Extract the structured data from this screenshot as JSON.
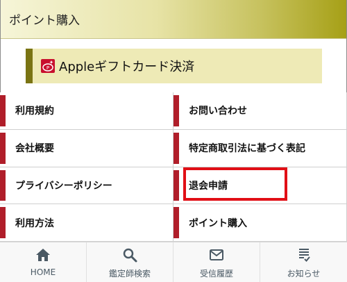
{
  "point_section": {
    "title": "ポイント購入",
    "apple_label": "Appleギフトカード決済"
  },
  "menu": {
    "items": [
      {
        "label": "利用規約"
      },
      {
        "label": "お問い合わせ"
      },
      {
        "label": "会社概要"
      },
      {
        "label": "特定商取引法に基づく表記"
      },
      {
        "label": "プライバシーポリシー"
      },
      {
        "label": "退会申請"
      },
      {
        "label": "利用方法"
      },
      {
        "label": "ポイント購入"
      }
    ]
  },
  "bottom_nav": {
    "items": [
      {
        "label": "HOME",
        "icon": "home-icon"
      },
      {
        "label": "鑑定師検索",
        "icon": "search-icon"
      },
      {
        "label": "受信履歴",
        "icon": "mail-icon"
      },
      {
        "label": "お知らせ",
        "icon": "notice-list-icon"
      }
    ]
  },
  "colors": {
    "accent_red": "#b01e2a",
    "highlight_red": "#e10f16",
    "olive": "#7a7413",
    "nav_icon": "#4a5964"
  }
}
